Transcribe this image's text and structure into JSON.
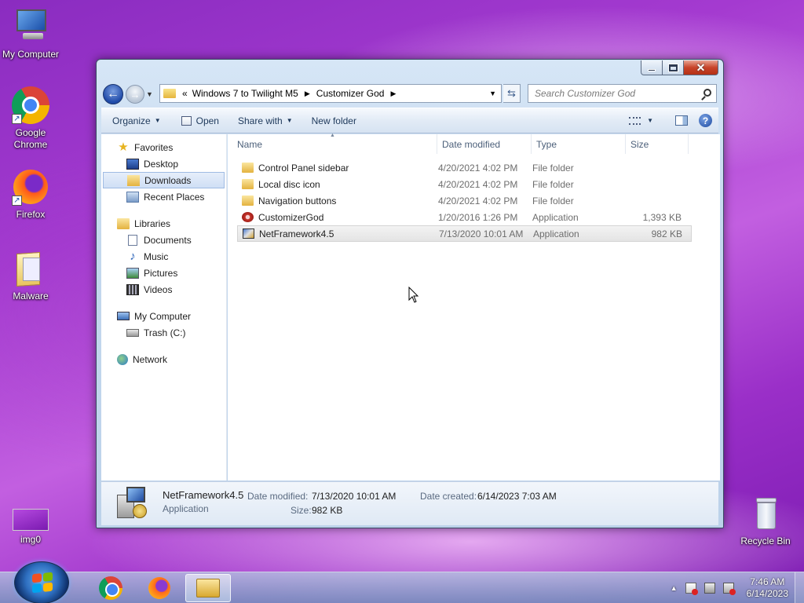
{
  "desktop": {
    "icons": [
      {
        "label": "My Computer"
      },
      {
        "label": "Google Chrome"
      },
      {
        "label": "Firefox"
      },
      {
        "label": "Malware"
      },
      {
        "label": "img0"
      },
      {
        "label": "Recycle Bin"
      }
    ]
  },
  "window": {
    "address": {
      "overflow": "«",
      "crumbs": [
        "Windows 7 to Twilight M5",
        "Customizer God"
      ]
    },
    "search_placeholder": "Search Customizer God",
    "toolbar": {
      "organize": "Organize",
      "open": "Open",
      "share_with": "Share with",
      "new_folder": "New folder"
    },
    "nav_pane": {
      "favorites": "Favorites",
      "desktop": "Desktop",
      "downloads": "Downloads",
      "recent_places": "Recent Places",
      "libraries": "Libraries",
      "documents": "Documents",
      "music": "Music",
      "pictures": "Pictures",
      "videos": "Videos",
      "my_computer": "My Computer",
      "trash_drive": "Trash (C:)",
      "network": "Network"
    },
    "columns": {
      "name": "Name",
      "date": "Date modified",
      "type": "Type",
      "size": "Size"
    },
    "files": [
      {
        "name": "Control Panel sidebar",
        "date": "4/20/2021 4:02 PM",
        "type": "File folder",
        "size": "",
        "icon": "folder-icon"
      },
      {
        "name": "Local disc icon",
        "date": "4/20/2021 4:02 PM",
        "type": "File folder",
        "size": "",
        "icon": "folder-icon"
      },
      {
        "name": "Navigation buttons",
        "date": "4/20/2021 4:02 PM",
        "type": "File folder",
        "size": "",
        "icon": "folder-icon"
      },
      {
        "name": "CustomizerGod",
        "date": "1/20/2016 1:26 PM",
        "type": "Application",
        "size": "1,393 KB",
        "icon": "gear-app-icon"
      },
      {
        "name": "NetFramework4.5",
        "date": "7/13/2020 10:01 AM",
        "type": "Application",
        "size": "982 KB",
        "icon": "setup-app-icon"
      }
    ],
    "details": {
      "name": "NetFramework4.5",
      "type": "Application",
      "date_modified_label": "Date modified:",
      "date_modified": "7/13/2020 10:01 AM",
      "size_label": "Size:",
      "size": "982 KB",
      "date_created_label": "Date created:",
      "date_created": "6/14/2023 7:03 AM"
    }
  },
  "taskbar": {
    "time": "7:46 AM",
    "date": "6/14/2023"
  }
}
